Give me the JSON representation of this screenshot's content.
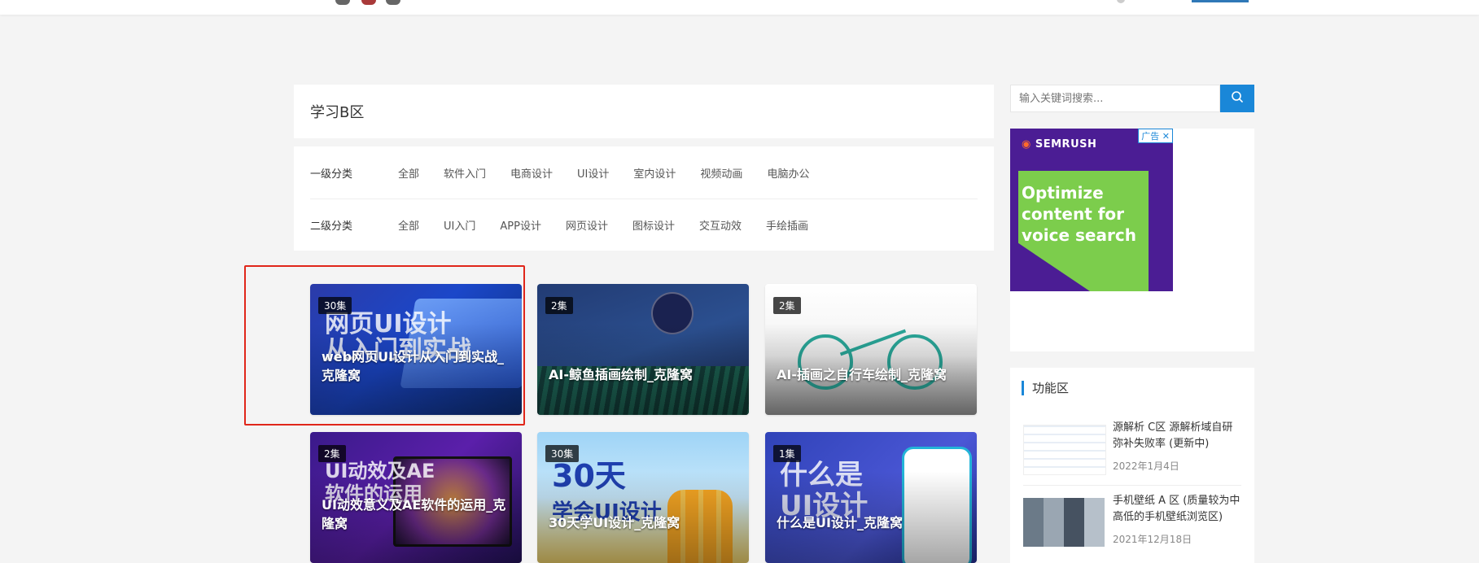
{
  "page": {
    "section_title": "学习B区"
  },
  "filters": {
    "primary": {
      "label": "一级分类",
      "options": [
        "全部",
        "软件入门",
        "电商设计",
        "UI设计",
        "室内设计",
        "视频动画",
        "电脑办公"
      ]
    },
    "secondary": {
      "label": "二级分类",
      "options": [
        "全部",
        "UI入门",
        "APP设计",
        "网页设计",
        "图标设计",
        "交互动效",
        "手绘插画"
      ]
    }
  },
  "cards": [
    {
      "badge": "30集",
      "title": "web网页UI设计从入门到实战_克隆窝",
      "art": "网页UI设计\n从入门到实战",
      "color": "#1b47c9"
    },
    {
      "badge": "2集",
      "title": "AI-鲸鱼插画绘制_克隆窝",
      "art": "",
      "color": "#2b4f8f"
    },
    {
      "badge": "2集",
      "title": "AI-插画之自行车绘制_克隆窝",
      "art": "",
      "color": "#2aa89a"
    },
    {
      "badge": "2集",
      "title": "UI动效意义及AE软件的运用_克隆窝",
      "art": "UI动效及AE\n软件的运用",
      "color": "#5b1faa"
    },
    {
      "badge": "30集",
      "title": "30天学UI设计_克隆窝",
      "art": "30天\n学会UI设计",
      "color": "#9fd4f6"
    },
    {
      "badge": "1集",
      "title": "什么是UI设计_克隆窝",
      "art": "什么是\nUI设计",
      "color": "#4b57d6"
    }
  ],
  "search": {
    "placeholder": "输入关键词搜索...",
    "icon": "search-icon"
  },
  "ad": {
    "brand": "SEMRUSH",
    "tag": "广告",
    "slogan": "Optimize content for voice search",
    "close": "✕"
  },
  "function_area": {
    "heading": "功能区",
    "items": [
      {
        "title": "源解析 C区 源解析域自研弥补失败率 (更新中)",
        "date": "2022年1月4日"
      },
      {
        "title": "手机壁纸 A 区 (质量较为中高低的手机壁纸浏览区)",
        "date": "2021年12月18日"
      }
    ]
  },
  "colors": {
    "accent": "#1a87d8",
    "highlight": "#e0261a"
  }
}
